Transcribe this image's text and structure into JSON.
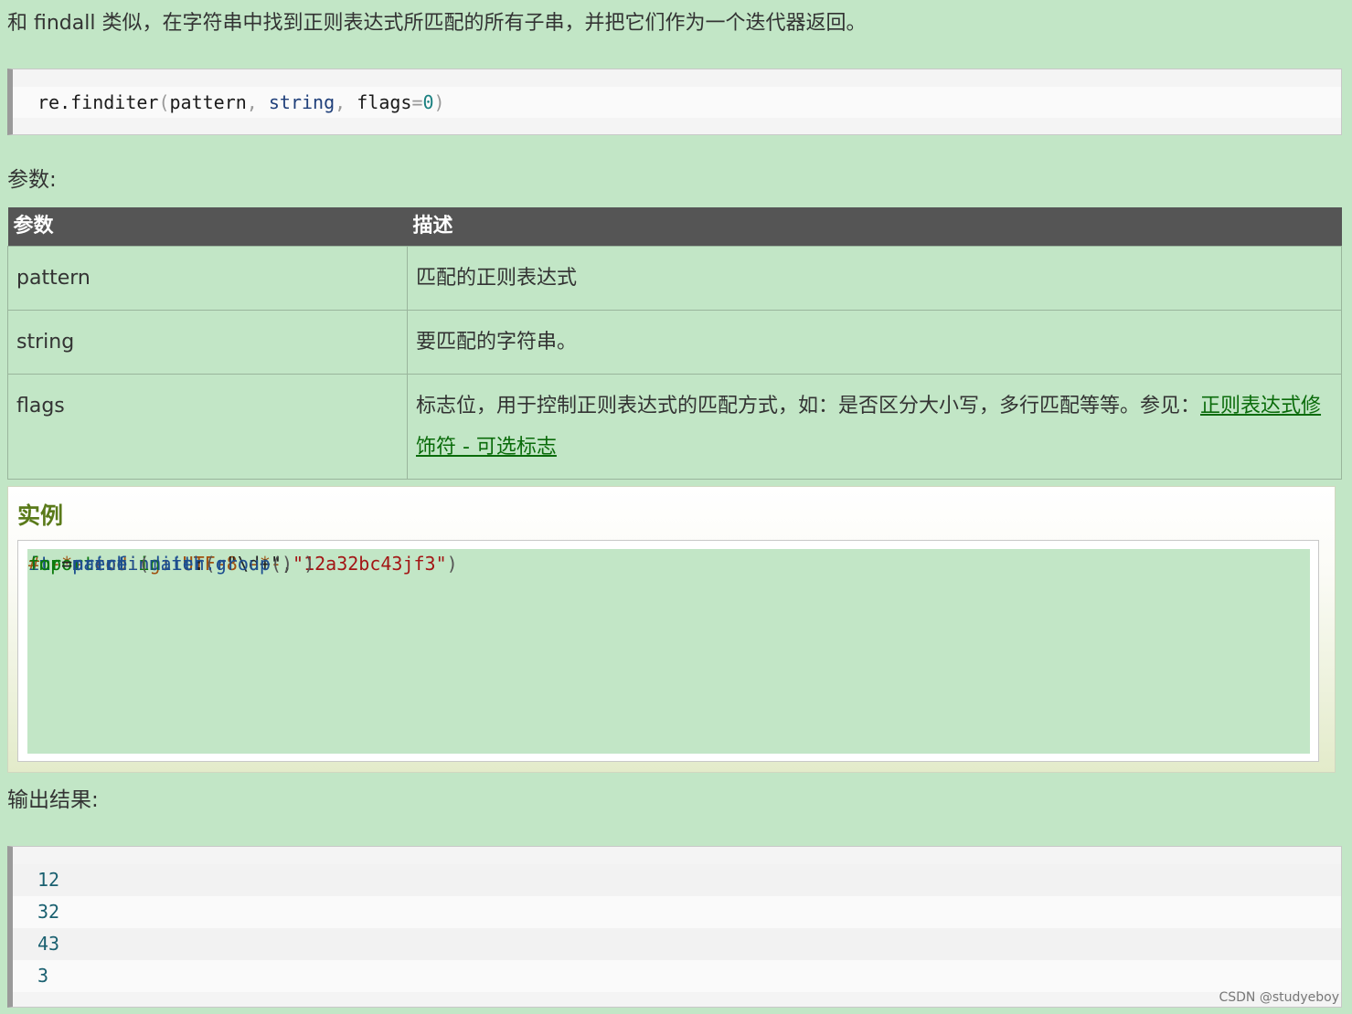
{
  "intro": "和 findall 类似，在字符串中找到正则表达式所匹配的所有子串，并把它们作为一个迭代器返回。",
  "signature": {
    "obj": "re.finditer",
    "open": "(",
    "p1": "pattern",
    "c1": ", ",
    "p2": "string",
    "c2": ", ",
    "p3": "flags",
    "eq": "=",
    "default": "0",
    "close": ")"
  },
  "params_heading": "参数:",
  "table": {
    "headers": [
      "参数",
      "描述"
    ],
    "rows": [
      {
        "name": "pattern",
        "desc": "匹配的正则表达式"
      },
      {
        "name": "string",
        "desc": "要匹配的字符串。"
      },
      {
        "name": "flags",
        "desc": "标志位，用于控制正则表达式的匹配方式，如：是否区分大小写，多行匹配等等。参见：",
        "link": "正则表达式修饰符 - 可选标志"
      }
    ]
  },
  "example": {
    "title": "实例",
    "code": {
      "line1": "# -*- coding: UTF-8 -*-",
      "import_kw": "import",
      "import_mod": "re",
      "it_var": "it",
      "it_eq": " = ",
      "it_call": "re.finditer",
      "it_open": "(",
      "it_r": "r",
      "it_s1q": "\"",
      "it_s1body": "\\d+",
      "it_s1close": "\"",
      "it_comma": ",",
      "it_s2": "\"12a32bc43jf3\"",
      "it_close": ")",
      "for_kw": "for",
      "for_var": "match",
      "in_kw": "in",
      "for_iter": "it",
      "for_colon": ":",
      "print_indent": "    ",
      "print_fn": "print",
      "print_open": " (",
      "print_call": "match.group",
      "print_parens": "()",
      "print_close": " )"
    }
  },
  "output_heading": "输出结果:",
  "output": [
    "12",
    "32",
    "43",
    "3"
  ],
  "watermark": "CSDN @studyeboy"
}
